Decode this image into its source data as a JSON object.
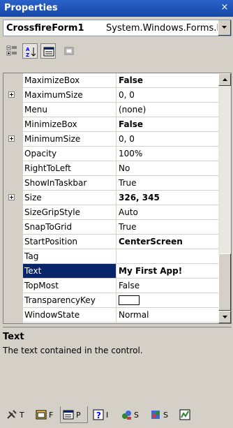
{
  "window": {
    "title": "Properties",
    "close": "×"
  },
  "selector": {
    "object_name": "CrossfireForm1",
    "object_type": "System.Windows.Forms.F"
  },
  "toolbar": {
    "categorized_icon": "categorized-icon",
    "alphabetical_icon": "alphabetical-icon",
    "properties_icon": "properties-icon",
    "property_pages_icon": "property-pages-icon"
  },
  "properties": [
    {
      "name": "MaximizeBox",
      "value": "False",
      "bold": true,
      "expandable": false
    },
    {
      "name": "MaximumSize",
      "value": "0, 0",
      "bold": false,
      "expandable": true
    },
    {
      "name": "Menu",
      "value": "(none)",
      "bold": false,
      "expandable": false
    },
    {
      "name": "MinimizeBox",
      "value": "False",
      "bold": true,
      "expandable": false
    },
    {
      "name": "MinimumSize",
      "value": "0, 0",
      "bold": false,
      "expandable": true
    },
    {
      "name": "Opacity",
      "value": "100%",
      "bold": false,
      "expandable": false
    },
    {
      "name": "RightToLeft",
      "value": "No",
      "bold": false,
      "expandable": false
    },
    {
      "name": "ShowInTaskbar",
      "value": "True",
      "bold": false,
      "expandable": false
    },
    {
      "name": "Size",
      "value": "326, 345",
      "bold": true,
      "expandable": true
    },
    {
      "name": "SizeGripStyle",
      "value": "Auto",
      "bold": false,
      "expandable": false
    },
    {
      "name": "SnapToGrid",
      "value": "True",
      "bold": false,
      "expandable": false
    },
    {
      "name": "StartPosition",
      "value": "CenterScreen",
      "bold": true,
      "expandable": false
    },
    {
      "name": "Tag",
      "value": "",
      "bold": false,
      "expandable": false
    },
    {
      "name": "Text",
      "value": "My First App!",
      "bold": true,
      "expandable": false,
      "selected": true
    },
    {
      "name": "TopMost",
      "value": "False",
      "bold": false,
      "expandable": false
    },
    {
      "name": "TransparencyKey",
      "value": "",
      "bold": false,
      "expandable": false,
      "swatch": "#ffffff"
    },
    {
      "name": "WindowState",
      "value": "Normal",
      "bold": false,
      "expandable": false
    }
  ],
  "description": {
    "title": "Text",
    "text": "The text contained in the control."
  },
  "tabs": [
    {
      "label": "T",
      "icon": "toolbox-icon",
      "active": false
    },
    {
      "label": "F",
      "icon": "form-icon",
      "active": false
    },
    {
      "label": "P",
      "icon": "properties-window-icon",
      "active": true
    },
    {
      "label": "I",
      "icon": "help-index-icon",
      "active": false
    },
    {
      "label": "S",
      "icon": "server-explorer-icon",
      "active": false
    },
    {
      "label": "S",
      "icon": "solution-explorer-icon",
      "active": false
    },
    {
      "label": "",
      "icon": "class-view-icon",
      "active": false
    }
  ]
}
